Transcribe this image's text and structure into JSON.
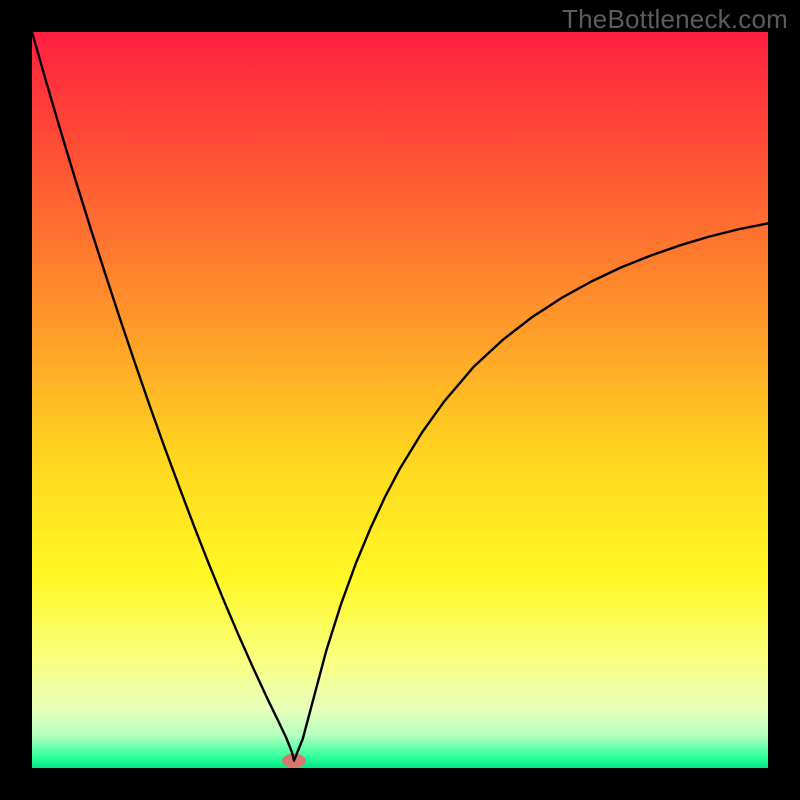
{
  "watermark": "TheBottleneck.com",
  "chart_data": {
    "type": "line",
    "title": "",
    "xlabel": "",
    "ylabel": "",
    "xlim": [
      0,
      100
    ],
    "ylim": [
      0,
      100
    ],
    "grid": false,
    "annotations": [],
    "background_gradient": {
      "stops": [
        {
          "pos": 0.0,
          "color": "#ff1f3f"
        },
        {
          "pos": 0.2,
          "color": "#ff5a32"
        },
        {
          "pos": 0.4,
          "color": "#ff9a2a"
        },
        {
          "pos": 0.58,
          "color": "#ffd61f"
        },
        {
          "pos": 0.74,
          "color": "#fff824"
        },
        {
          "pos": 0.85,
          "color": "#faff7e"
        },
        {
          "pos": 0.92,
          "color": "#e8ffbb"
        },
        {
          "pos": 0.955,
          "color": "#b6ffbf"
        },
        {
          "pos": 0.985,
          "color": "#2fff9d"
        },
        {
          "pos": 1.0,
          "color": "#00e885"
        }
      ]
    },
    "series": [
      {
        "name": "curve",
        "color": "#000000",
        "stroke_width": 2.4,
        "x": [
          0.0,
          2.0,
          4.0,
          6.0,
          8.0,
          10.0,
          12.0,
          14.0,
          16.0,
          18.0,
          20.0,
          22.0,
          24.0,
          26.0,
          28.0,
          30.0,
          32.0,
          33.5,
          34.5,
          35.3,
          35.6,
          36.8,
          38.0,
          40.0,
          42.0,
          44.0,
          46.0,
          48.0,
          50.0,
          53.0,
          56.0,
          60.0,
          64.0,
          68.0,
          72.0,
          76.0,
          80.0,
          84.0,
          88.0,
          92.0,
          96.0,
          100.0
        ],
        "y": [
          100.0,
          93.0,
          86.2,
          79.6,
          73.2,
          67.0,
          60.9,
          55.0,
          49.2,
          43.6,
          38.2,
          32.9,
          27.8,
          22.9,
          18.2,
          13.7,
          9.4,
          6.3,
          4.2,
          2.2,
          1.0,
          4.0,
          8.5,
          16.0,
          22.3,
          27.8,
          32.6,
          36.9,
          40.7,
          45.6,
          49.8,
          54.5,
          58.2,
          61.3,
          63.9,
          66.1,
          68.0,
          69.6,
          71.0,
          72.2,
          73.2,
          74.0
        ]
      }
    ],
    "marker": {
      "name": "optimum-marker",
      "x": 35.6,
      "y": 1.0,
      "color": "#d6786d",
      "rx": 12,
      "ry": 7
    }
  }
}
